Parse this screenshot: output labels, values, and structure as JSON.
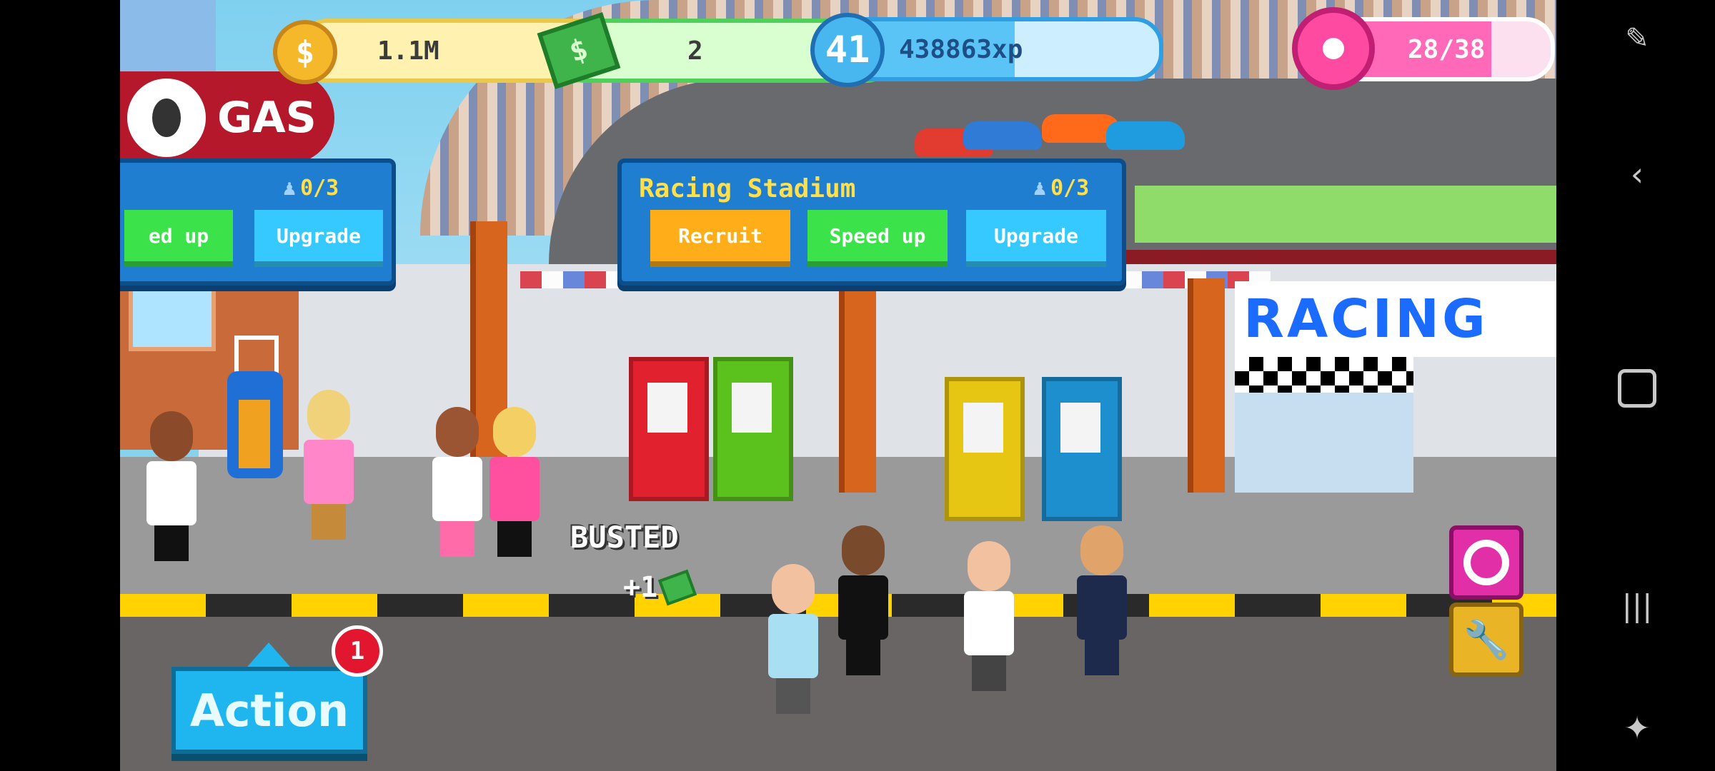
{
  "hud": {
    "coins": "1.1M",
    "coins_plus": "+",
    "cash": "2",
    "cash_plus": "+",
    "level": "41",
    "xp": "438863xp",
    "donuts": "28/38",
    "donut_fill_fraction": 0.74,
    "xp_fill_fraction": 0.55
  },
  "gas_sign": "GAS",
  "left_panel": {
    "count": "0/3",
    "speed_up": "ed up",
    "upgrade": "Upgrade"
  },
  "stadium_panel": {
    "title": "Racing Stadium",
    "count": "0/3",
    "recruit": "Recruit",
    "speed_up": "Speed up",
    "upgrade": "Upgrade"
  },
  "racing_sign": "RACING",
  "busted_text": "BUSTED",
  "reward_text": "+1",
  "action": {
    "label": "Action",
    "badge": "1"
  },
  "icons": {
    "coin": "$",
    "cash": "$"
  },
  "colors": {
    "panel_blue": "#1f7ed0",
    "title_yellow": "#ffe04a",
    "recruit_orange": "#ffae1a",
    "speed_green": "#3ce24a",
    "upgrade_cyan": "#35c9ff",
    "donut_pink": "#ff4aa2"
  }
}
